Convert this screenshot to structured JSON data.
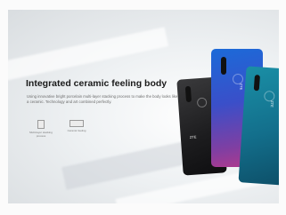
{
  "banner": {
    "headline": "Integrated ceramic feeling body",
    "description": "Using innovative bright porcelain multi-layer stacking process to make the body looks like a ceramic. Technology and art combined perfectly.",
    "features": [
      {
        "label": "Multi-layer stacking process",
        "icon": "layers-icon"
      },
      {
        "label": "Ceramic feeling",
        "icon": "ceramic-icon"
      }
    ]
  },
  "phones": [
    {
      "color": "#1c1c1e",
      "logo": "ZTE"
    },
    {
      "color": "#3a4fc9",
      "logo": "ZTE"
    },
    {
      "color": "#136f8c",
      "logo": "ZTE"
    }
  ]
}
